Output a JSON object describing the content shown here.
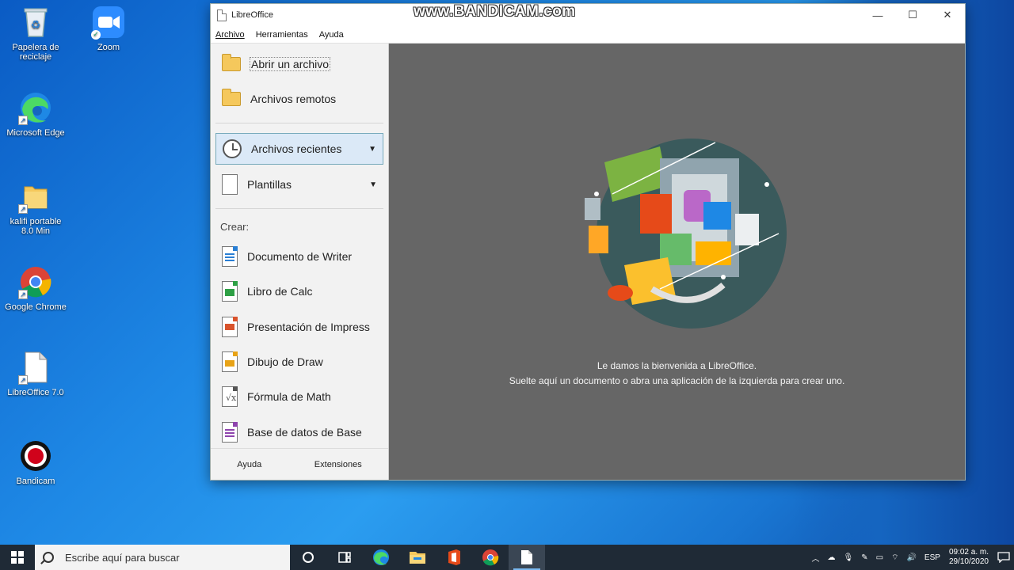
{
  "desktop": {
    "icons": [
      {
        "label": "Papelera de reciclaje",
        "icon": "recycle-bin-icon"
      },
      {
        "label": "Zoom",
        "icon": "zoom-icon"
      },
      {
        "label": "Microsoft Edge",
        "icon": "edge-icon"
      },
      {
        "label": "kalifi portable 8.0 Min",
        "icon": "folder-icon"
      },
      {
        "label": "Google Chrome",
        "icon": "chrome-icon"
      },
      {
        "label": "LibreOffice 7.0",
        "icon": "libreoffice-icon"
      },
      {
        "label": "Bandicam",
        "icon": "bandicam-icon"
      }
    ]
  },
  "watermark": "www.BANDICAM.com",
  "window": {
    "title": "LibreOffice",
    "controls": {
      "minimize": "—",
      "maximize": "☐",
      "close": "✕"
    },
    "menu": [
      "Archivo",
      "Herramientas",
      "Ayuda"
    ],
    "sidebar": {
      "open_file": "Abrir un archivo",
      "remote_files": "Archivos remotos",
      "recent_files": "Archivos recientes",
      "templates": "Plantillas",
      "create_label": "Crear:",
      "create_items": [
        {
          "label": "Documento de Writer",
          "color": "#2a7fd4"
        },
        {
          "label": "Libro de Calc",
          "color": "#2ea045"
        },
        {
          "label": "Presentación de Impress",
          "color": "#d9532c"
        },
        {
          "label": "Dibujo de Draw",
          "color": "#e8a317"
        },
        {
          "label": "Fórmula de Math",
          "color": "#555555"
        },
        {
          "label": "Base de datos de Base",
          "color": "#8e44ad"
        }
      ],
      "footer": {
        "help": "Ayuda",
        "extensions": "Extensiones"
      }
    },
    "welcome": {
      "line1": "Le damos la bienvenida a LibreOffice.",
      "line2": "Suelte aquí un documento o abra una aplicación de la izquierda para crear uno."
    }
  },
  "taskbar": {
    "search_placeholder": "Escribe aquí para buscar",
    "apps": [
      "cortana-icon",
      "task-view-icon",
      "edge-icon",
      "file-explorer-icon",
      "office-icon",
      "chrome-icon",
      "libreoffice-icon"
    ],
    "tray": {
      "language": "ESP",
      "time": "09:02 a. m.",
      "date": "29/10/2020"
    }
  }
}
